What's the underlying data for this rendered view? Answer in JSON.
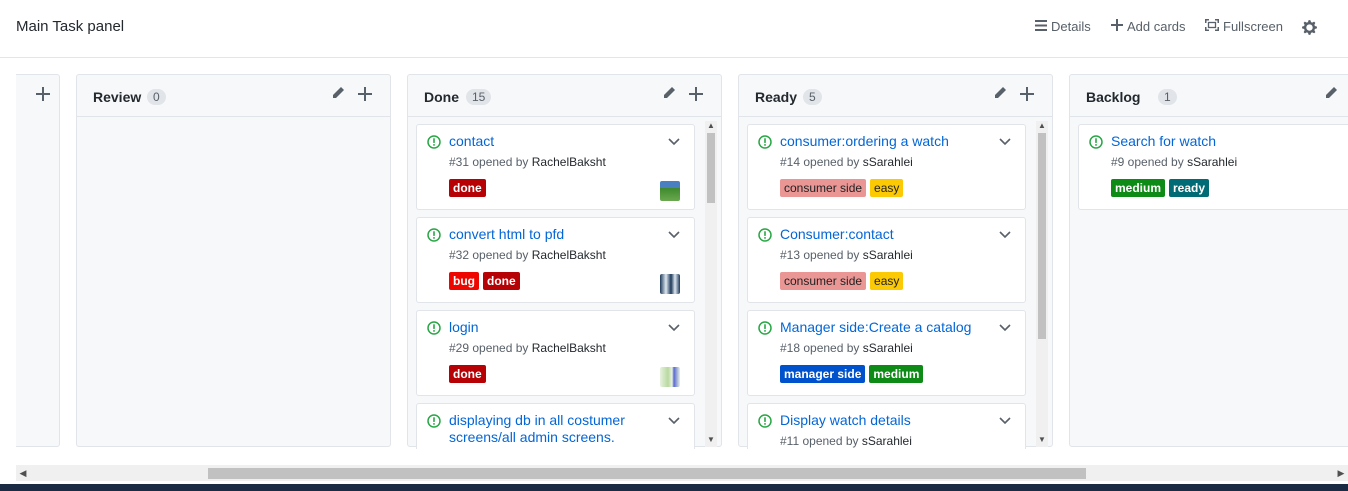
{
  "header": {
    "title": "Main Task panel",
    "details_label": "Details",
    "add_cards_label": "Add cards",
    "fullscreen_label": "Fullscreen"
  },
  "columns": [
    {
      "name": "Review",
      "count": "0",
      "cards": []
    },
    {
      "name": "Done",
      "count": "15",
      "cards": [
        {
          "title": "contact",
          "meta_prefix": "#31 opened by",
          "user": "RachelBaksht",
          "labels": [
            {
              "text": "done",
              "color": "#b60205"
            }
          ]
        },
        {
          "title": "convert html to pfd",
          "meta_prefix": "#32 opened by",
          "user": "RachelBaksht",
          "labels": [
            {
              "text": "bug",
              "color": "#ee0701"
            },
            {
              "text": "done",
              "color": "#b60205"
            }
          ]
        },
        {
          "title": "login",
          "meta_prefix": "#29 opened by",
          "user": "RachelBaksht",
          "labels": [
            {
              "text": "done",
              "color": "#b60205"
            }
          ]
        },
        {
          "title": "displaying db in all costumer screens/all admin screens.",
          "meta_prefix": "",
          "user": "",
          "labels": []
        }
      ]
    },
    {
      "name": "Ready",
      "count": "5",
      "cards": [
        {
          "title": "consumer:ordering a watch",
          "meta_prefix": "#14 opened by",
          "user": "sSarahlei",
          "labels": [
            {
              "text": "consumer side",
              "color": "#e99695"
            },
            {
              "text": "easy",
              "color": "#fbca04"
            }
          ]
        },
        {
          "title": "Consumer:contact",
          "meta_prefix": "#13 opened by",
          "user": "sSarahlei",
          "labels": [
            {
              "text": "consumer side",
              "color": "#e99695"
            },
            {
              "text": "easy",
              "color": "#fbca04"
            }
          ]
        },
        {
          "title": "Manager side:Create a catalog",
          "meta_prefix": "#18 opened by",
          "user": "sSarahlei",
          "labels": [
            {
              "text": "manager side",
              "color": "#0052cc"
            },
            {
              "text": "medium",
              "color": "#0e8a16"
            }
          ]
        },
        {
          "title": "Display watch details",
          "meta_prefix": "#11 opened by",
          "user": "sSarahlei",
          "labels": []
        }
      ]
    },
    {
      "name": "Backlog",
      "count": "1",
      "cards": [
        {
          "title": "Search for watch",
          "meta_prefix": "#9 opened by",
          "user": "sSarahlei",
          "labels": [
            {
              "text": "medium",
              "color": "#0e8a16"
            },
            {
              "text": "ready",
              "color": "#006b75"
            }
          ]
        }
      ]
    }
  ],
  "icons": {
    "issue": "issue-opened-icon",
    "chevron": "chevron-down-icon",
    "edit": "pencil-icon",
    "add": "plus-icon",
    "settings": "gear-icon"
  },
  "colors": {
    "issue_open": "#28a745",
    "link": "#0366d6"
  }
}
